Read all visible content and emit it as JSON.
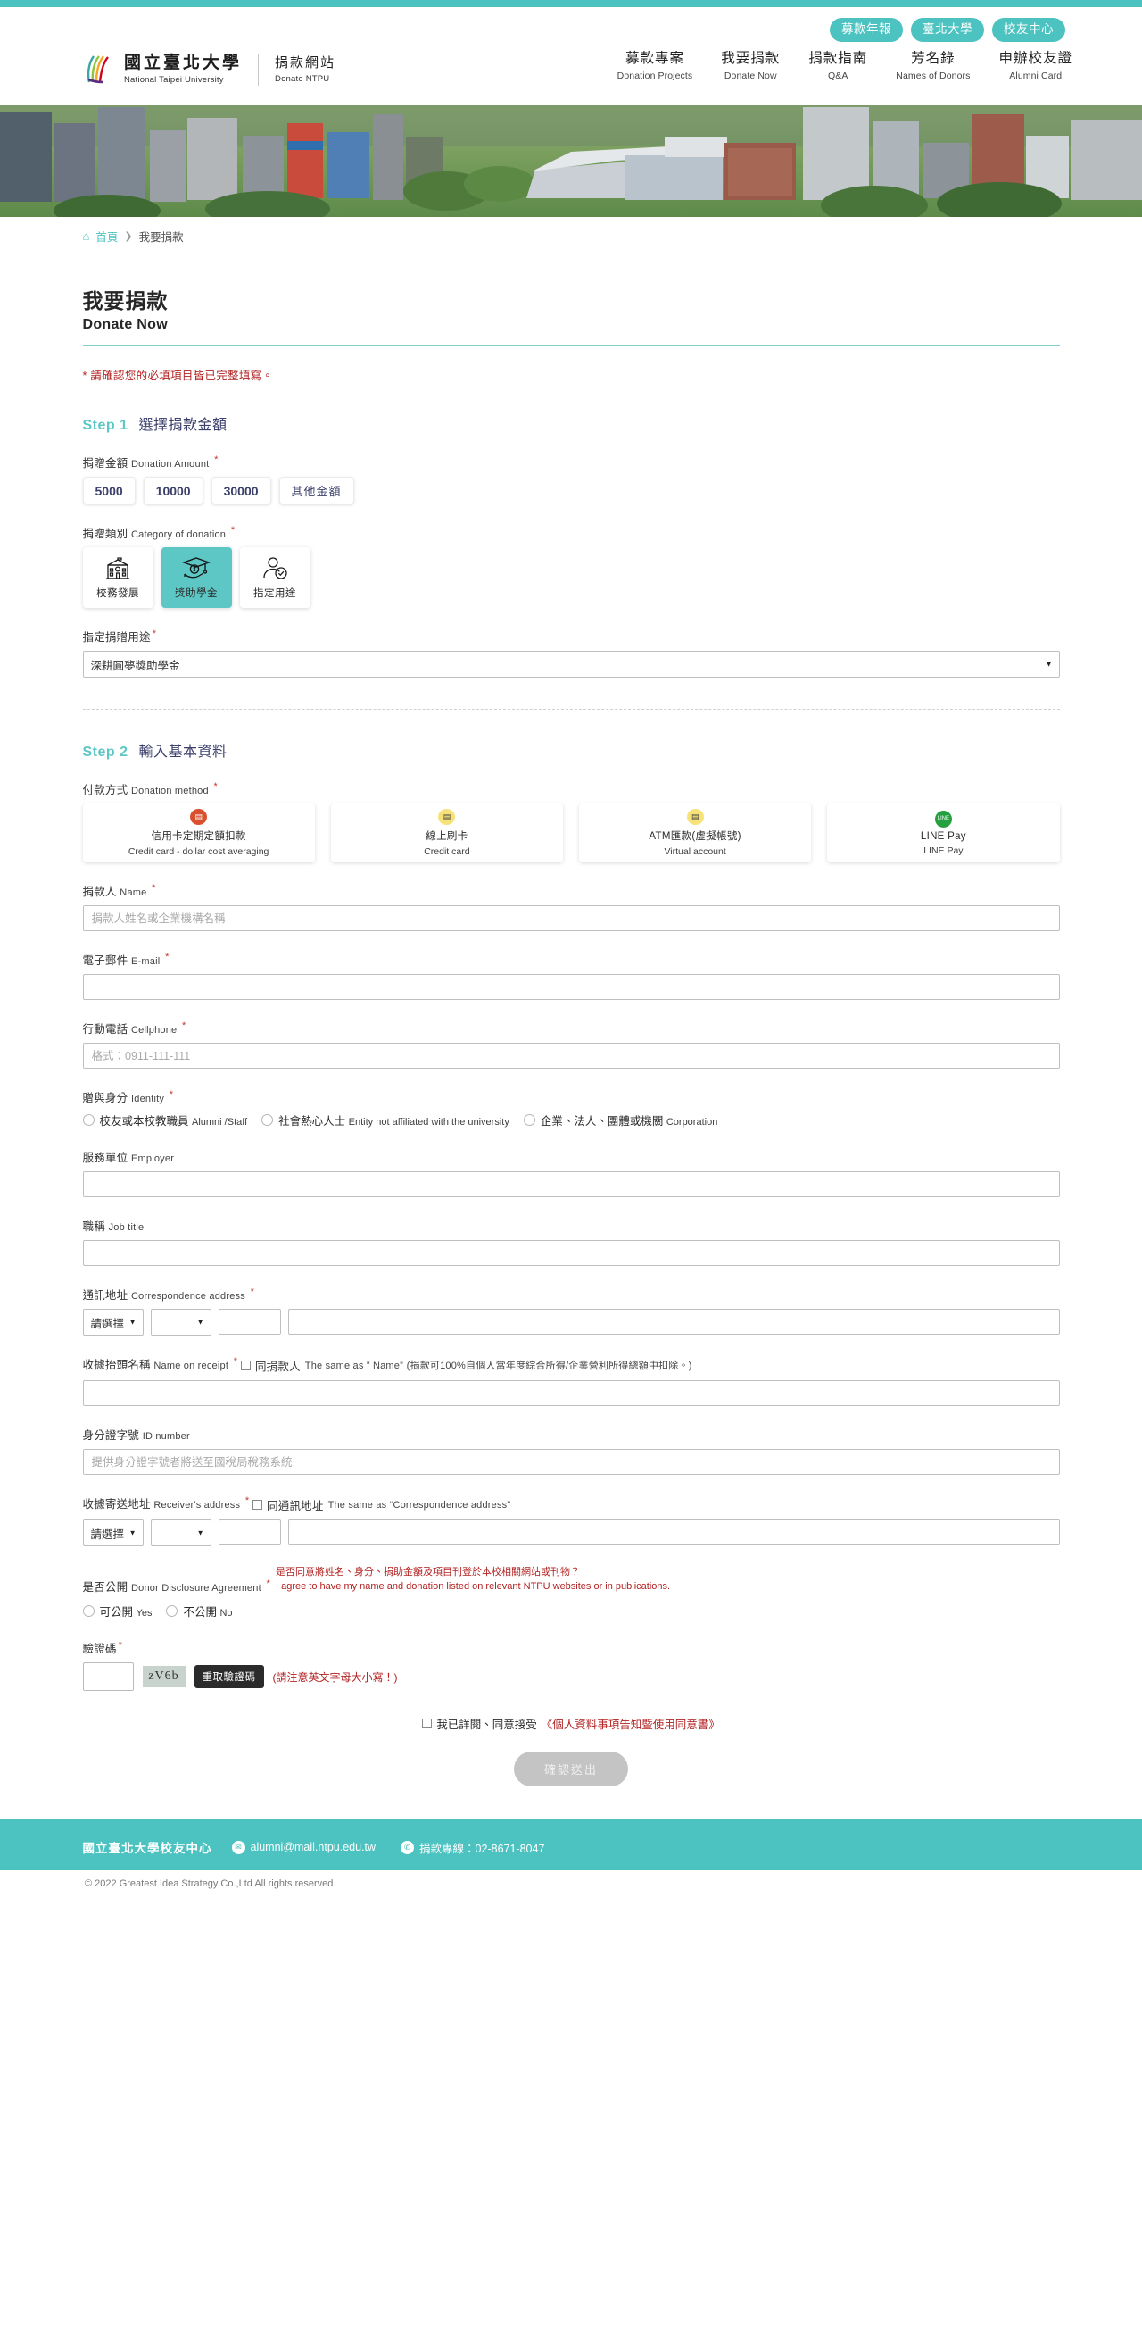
{
  "header": {
    "pills": [
      {
        "label": "募款年報",
        "name": "pill-annual-report"
      },
      {
        "label": "臺北大學",
        "name": "pill-ntpu"
      },
      {
        "label": "校友中心",
        "name": "pill-alumni-center"
      }
    ],
    "brand": {
      "univ_cn": "國立臺北大學",
      "univ_en": "National Taipei University",
      "site_cn": "捐款網站",
      "site_en": "Donate NTPU"
    },
    "nav": [
      {
        "cn": "募款專案",
        "en": "Donation Projects"
      },
      {
        "cn": "我要捐款",
        "en": "Donate Now"
      },
      {
        "cn": "捐款指南",
        "en": "Q&A"
      },
      {
        "cn": "芳名錄",
        "en": "Names of Donors"
      },
      {
        "cn": "申辦校友證",
        "en": "Alumni Card"
      }
    ]
  },
  "breadcrumb": {
    "home": "首頁",
    "separator": "❯",
    "current": "我要捐款"
  },
  "page": {
    "title_cn": "我要捐款",
    "title_en": "Donate Now",
    "required_note": "* 請確認您的必填項目皆已完整填寫。"
  },
  "step1": {
    "number": "Step 1",
    "title": "選擇捐款金額",
    "amount": {
      "label_cn": "捐贈金額",
      "label_en": "Donation Amount",
      "options": [
        "5000",
        "10000",
        "30000",
        "其他金額"
      ]
    },
    "category": {
      "label_cn": "捐贈類別",
      "label_en": "Category of donation",
      "options": [
        {
          "label": "校務發展",
          "icon": "school-building-icon",
          "selected": false
        },
        {
          "label": "獎助學金",
          "icon": "graduation-cap-money-icon",
          "selected": true
        },
        {
          "label": "指定用途",
          "icon": "person-check-icon",
          "selected": false
        }
      ]
    },
    "purpose": {
      "label_cn": "指定捐贈用途",
      "value": "深耕圓夢獎助學金"
    }
  },
  "step2": {
    "number": "Step 2",
    "title": "輸入基本資料",
    "method": {
      "label_cn": "付款方式",
      "label_en": "Donation method",
      "options": [
        {
          "cn": "信用卡定期定額扣款",
          "en": "Credit card - dollar cost averaging",
          "icon": "hand-card-icon",
          "color": "#d9502e"
        },
        {
          "cn": "線上刷卡",
          "en": "Credit card",
          "icon": "credit-card-icon",
          "color": "#f7e27a"
        },
        {
          "cn": "ATM匯款(虛擬帳號)",
          "en": "Virtual account",
          "icon": "credit-card-icon",
          "color": "#f7e27a"
        },
        {
          "cn": "LINE Pay",
          "en": "LINE Pay",
          "icon": "line-pay-icon",
          "color": "#23a councils"
        }
      ]
    },
    "name": {
      "label_cn": "捐款人",
      "label_en": "Name",
      "placeholder": "捐款人姓名或企業機構名稱",
      "value": ""
    },
    "email": {
      "label_cn": "電子郵件",
      "label_en": "E-mail",
      "placeholder": "",
      "value": ""
    },
    "cellphone": {
      "label_cn": "行動電話",
      "label_en": "Cellphone",
      "placeholder": "格式：0911-111-111",
      "value": ""
    },
    "identity": {
      "label_cn": "贈與身分",
      "label_en": "Identity",
      "options": [
        {
          "cn": "校友或本校教職員",
          "en": "Alumni /Staff"
        },
        {
          "cn": "社會熱心人士",
          "en": "Entity not affiliated with the university"
        },
        {
          "cn": "企業、法人、團體或機關",
          "en": "Corporation"
        }
      ]
    },
    "employer": {
      "label_cn": "服務單位",
      "label_en": "Employer",
      "value": ""
    },
    "jobtitle": {
      "label_cn": "職稱",
      "label_en": "Job title",
      "value": ""
    },
    "correspondence_address": {
      "label_cn": "通訊地址",
      "label_en": "Correspondence address",
      "select1": "請選擇",
      "select2": "",
      "zip": "",
      "detail": ""
    },
    "receipt_name": {
      "label_cn": "收據抬頭名稱",
      "label_en": "Name on receipt",
      "checkbox_cn": "同捐款人",
      "checkbox_en": "The same as ” Name”",
      "note": "(捐款可100%自個人當年度綜合所得/企業營利所得總額中扣除。)",
      "value": ""
    },
    "id_number": {
      "label_cn": "身分證字號",
      "label_en": "ID number",
      "placeholder": "提供身分證字號者將送至國稅局稅務系統",
      "value": ""
    },
    "receiver_address": {
      "label_cn": "收據寄送地址",
      "label_en": "Receiver's address",
      "checkbox_cn": "同通訊地址",
      "checkbox_en": "The same as “Correspondence address”",
      "select1": "請選擇",
      "select2": "",
      "zip": "",
      "detail": ""
    },
    "disclosure": {
      "label_cn": "是否公開",
      "label_en": "Donor Disclosure Agreement",
      "note_cn": "是否同意將姓名、身分、捐助金額及項目刊登於本校相關網站或刊物？",
      "note_en": "I agree to have my name and donation listed on relevant NTPU websites or in publications.",
      "options": [
        {
          "cn": "可公開",
          "en": "Yes"
        },
        {
          "cn": "不公開",
          "en": "No"
        }
      ]
    },
    "captcha": {
      "label_cn": "驗證碼",
      "code": "zV6b",
      "refresh_label": "重取驗證碼",
      "hint": "(請注意英文字母大小寫！)",
      "value": ""
    },
    "agree": {
      "text": "我已詳閱、同意接受",
      "link": "《個人資料事項告知暨使用同意書》"
    },
    "submit_label": "確認送出"
  },
  "footer": {
    "title": "國立臺北大學校友中心",
    "email_icon": "envelope-icon",
    "email": "alumni@mail.ntpu.edu.tw",
    "phone_icon": "phone-icon",
    "phone": "捐款專線：02-8671-8047",
    "copyright": "© 2022 Greatest Idea Strategy Co.,Ltd All rights reserved."
  },
  "colors": {
    "accent": "#4cc3c0",
    "accent_light": "#5cc7c4",
    "navy": "#3b3f6b",
    "danger": "#b22222"
  }
}
